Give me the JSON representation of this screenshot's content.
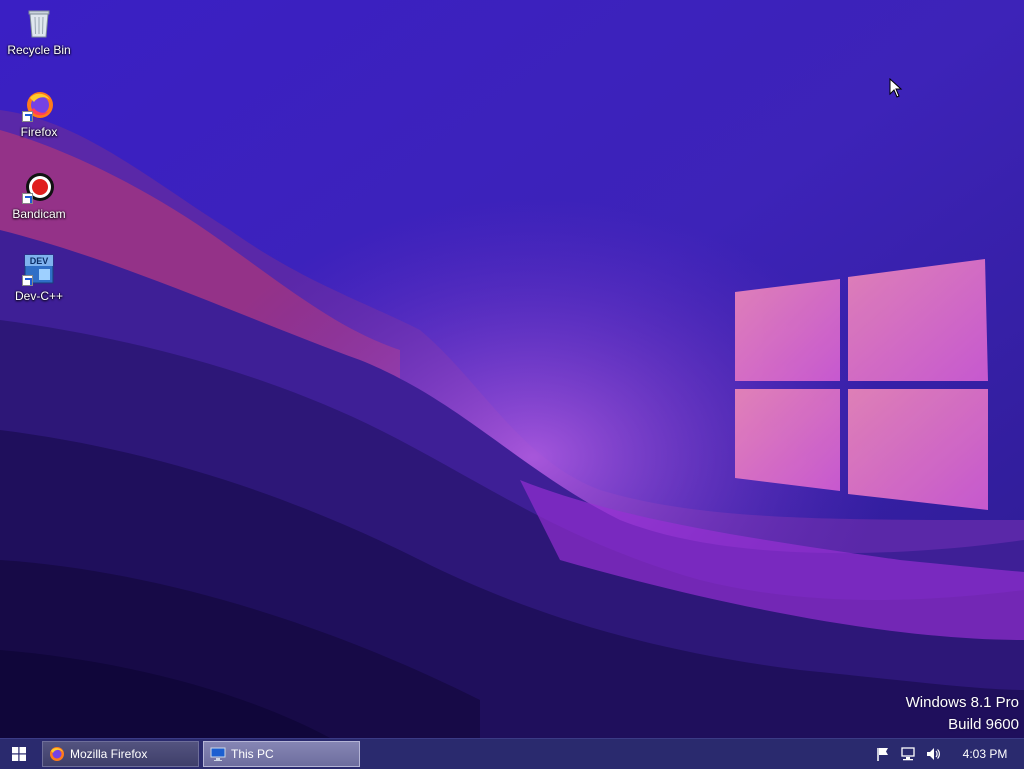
{
  "desktop": {
    "icons": [
      {
        "label": "Recycle Bin",
        "icon": "recycle-bin-icon"
      },
      {
        "label": "Firefox",
        "icon": "firefox-icon"
      },
      {
        "label": "Bandicam",
        "icon": "bandicam-icon"
      },
      {
        "label": "Dev-C++",
        "icon": "dev-cpp-icon"
      }
    ],
    "watermark": {
      "line1": "Windows 8.1 Pro",
      "line2": "Build 9600"
    }
  },
  "taskbar": {
    "start_icon": "windows-logo-icon",
    "buttons": [
      {
        "label": "Mozilla Firefox",
        "icon": "firefox-icon",
        "active": false
      },
      {
        "label": "This PC",
        "icon": "computer-icon",
        "active": true
      }
    ],
    "tray": {
      "icons": [
        "action-center-flag-icon",
        "network-icon",
        "volume-icon"
      ],
      "clock": "4:03 PM"
    }
  },
  "colors": {
    "taskbar": "#2a2a6e",
    "wallpaper_base": "#2a1a8c",
    "logo_pink": "#e873b5"
  }
}
